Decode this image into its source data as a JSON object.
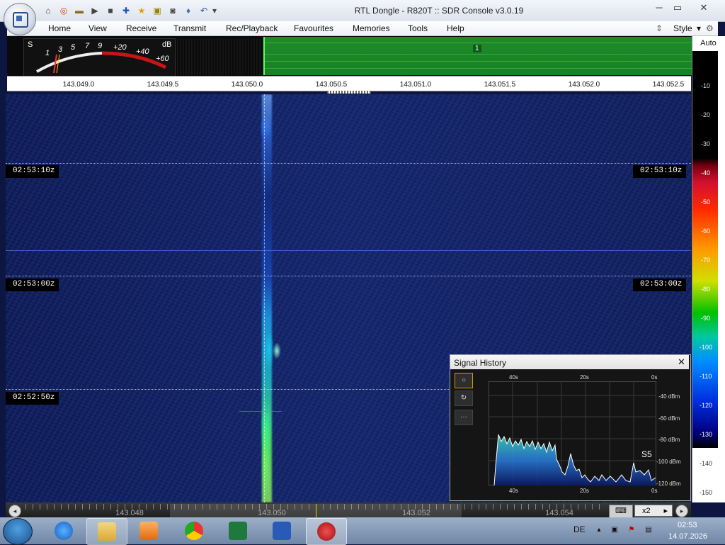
{
  "window": {
    "title": "RTL Dongle - R820T :: SDR Console v3.0.19"
  },
  "menu": [
    "Home",
    "View",
    "Receive",
    "Transmit",
    "Rec/Playback",
    "Favourites",
    "Memories",
    "Tools",
    "Help"
  ],
  "style_label": "Style",
  "meter": {
    "s_label": "S",
    "db_label": "dB",
    "scale": [
      "1",
      "3",
      "5",
      "7",
      "9",
      "+20",
      "+40",
      "+60"
    ]
  },
  "band": {
    "marker": "1"
  },
  "freq_labels": [
    "143.049.0",
    "143.049.5",
    "143.050.0",
    "143.050.5",
    "143.051.0",
    "143.051.5",
    "143.052.0",
    "143.052.5"
  ],
  "waterfall": {
    "times": [
      "02:53:10z",
      "02:53:00z",
      "02:52:50z"
    ]
  },
  "db_scale": {
    "auto": "Auto",
    "labels": [
      "-10",
      "-20",
      "-30",
      "-40",
      "-50",
      "-60",
      "-70",
      "-80",
      "-90",
      "-100",
      "-110",
      "-120",
      "-130",
      "-140",
      "-150"
    ]
  },
  "tuner": {
    "labels": [
      "143.048",
      "143.050",
      "143.052",
      "143.054"
    ],
    "zoom": "x2"
  },
  "signal_history": {
    "title": "Signal History",
    "top_ticks": [
      "40s",
      "20s",
      "0s"
    ],
    "bottom_ticks": [
      "40s",
      "20s",
      "0s"
    ],
    "dbm_labels": [
      "-40 dBm",
      "-60 dBm",
      "-80 dBm",
      "-100 dBm",
      "-120 dBm"
    ],
    "s_reading": "S5",
    "buttons": [
      "○",
      "↻",
      "···"
    ]
  },
  "taskbar": {
    "language": "DE",
    "time": "02:53",
    "date": "14.07.2026"
  },
  "colors": {
    "accent_green": "#59ff5b",
    "waterfall_bg": "#0d1a52"
  }
}
